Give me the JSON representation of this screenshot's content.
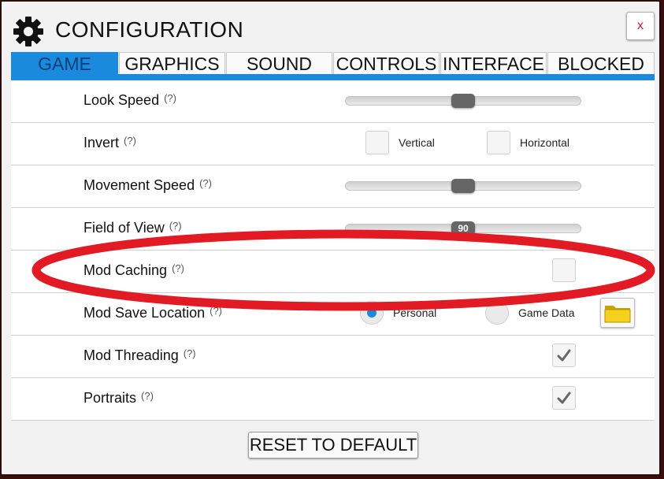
{
  "window": {
    "title": "CONFIGURATION",
    "close_label": "x"
  },
  "tabs": [
    {
      "label": "GAME",
      "active": true
    },
    {
      "label": "GRAPHICS",
      "active": false
    },
    {
      "label": "SOUND",
      "active": false
    },
    {
      "label": "CONTROLS",
      "active": false
    },
    {
      "label": "INTERFACE",
      "active": false
    },
    {
      "label": "BLOCKED",
      "active": false
    }
  ],
  "help_marker": "(?)",
  "settings": {
    "look_speed": {
      "label": "Look Speed",
      "value_fraction": 0.5
    },
    "invert": {
      "label": "Invert",
      "vertical_label": "Vertical",
      "vertical_checked": false,
      "horizontal_label": "Horizontal",
      "horizontal_checked": false
    },
    "movement_speed": {
      "label": "Movement Speed",
      "value_fraction": 0.5
    },
    "field_of_view": {
      "label": "Field of View",
      "value": "90",
      "value_fraction": 0.5
    },
    "mod_caching": {
      "label": "Mod Caching",
      "checked": false
    },
    "mod_save_location": {
      "label": "Mod Save Location",
      "option_1_label": "Personal",
      "option_1_selected": true,
      "option_2_label": "Game Data",
      "option_2_selected": false
    },
    "mod_threading": {
      "label": "Mod Threading",
      "checked": true
    },
    "portraits": {
      "label": "Portraits",
      "checked": true
    }
  },
  "footer": {
    "reset_label": "RESET TO DEFAULT"
  },
  "colors": {
    "accent": "#1a8bdc",
    "annotation_ellipse": "#e11a24",
    "close_x": "#d01818"
  },
  "icons": [
    "gear-icon",
    "close-icon",
    "help-icon",
    "check-icon",
    "folder-icon"
  ]
}
